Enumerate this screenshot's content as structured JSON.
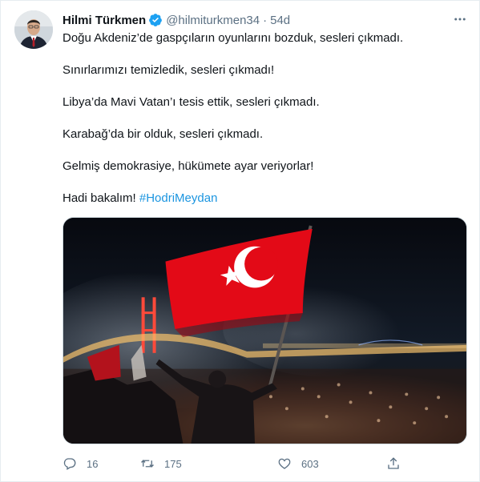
{
  "tweet": {
    "author_name": "Hilmi Türkmen",
    "handle": "@hilmiturkmen34",
    "separator": "·",
    "time": "54d",
    "verified": true,
    "paragraphs": [
      "Doğu Akdeniz’de gaspçıların oyunlarını bozduk, sesleri çıkmadı.",
      "Sınırlarımızı temizledik, sesleri çıkmadı!",
      "Libya’da Mavi Vatan’ı tesis ettik, sesleri çıkmadı.",
      "Karabağ’da bir olduk, sesleri çıkmadı.",
      "Gelmiş demokrasiye, hükümete ayar veriyorlar!"
    ],
    "last_line_prefix": "Hadi bakalım! ",
    "hashtag": "#HodriMeydan",
    "counts": {
      "replies": "16",
      "retweets": "175",
      "likes": "603"
    }
  },
  "icons": {
    "verified": "verified-badge-icon",
    "more": "more-options-icon",
    "reply": "reply-icon",
    "retweet": "retweet-icon",
    "like": "heart-icon",
    "share": "share-icon"
  },
  "colors": {
    "accent": "#1b95e0",
    "verified": "#1da1f2",
    "muted": "#5b7083",
    "text": "#0f1419",
    "flag_red": "#e30a17"
  }
}
